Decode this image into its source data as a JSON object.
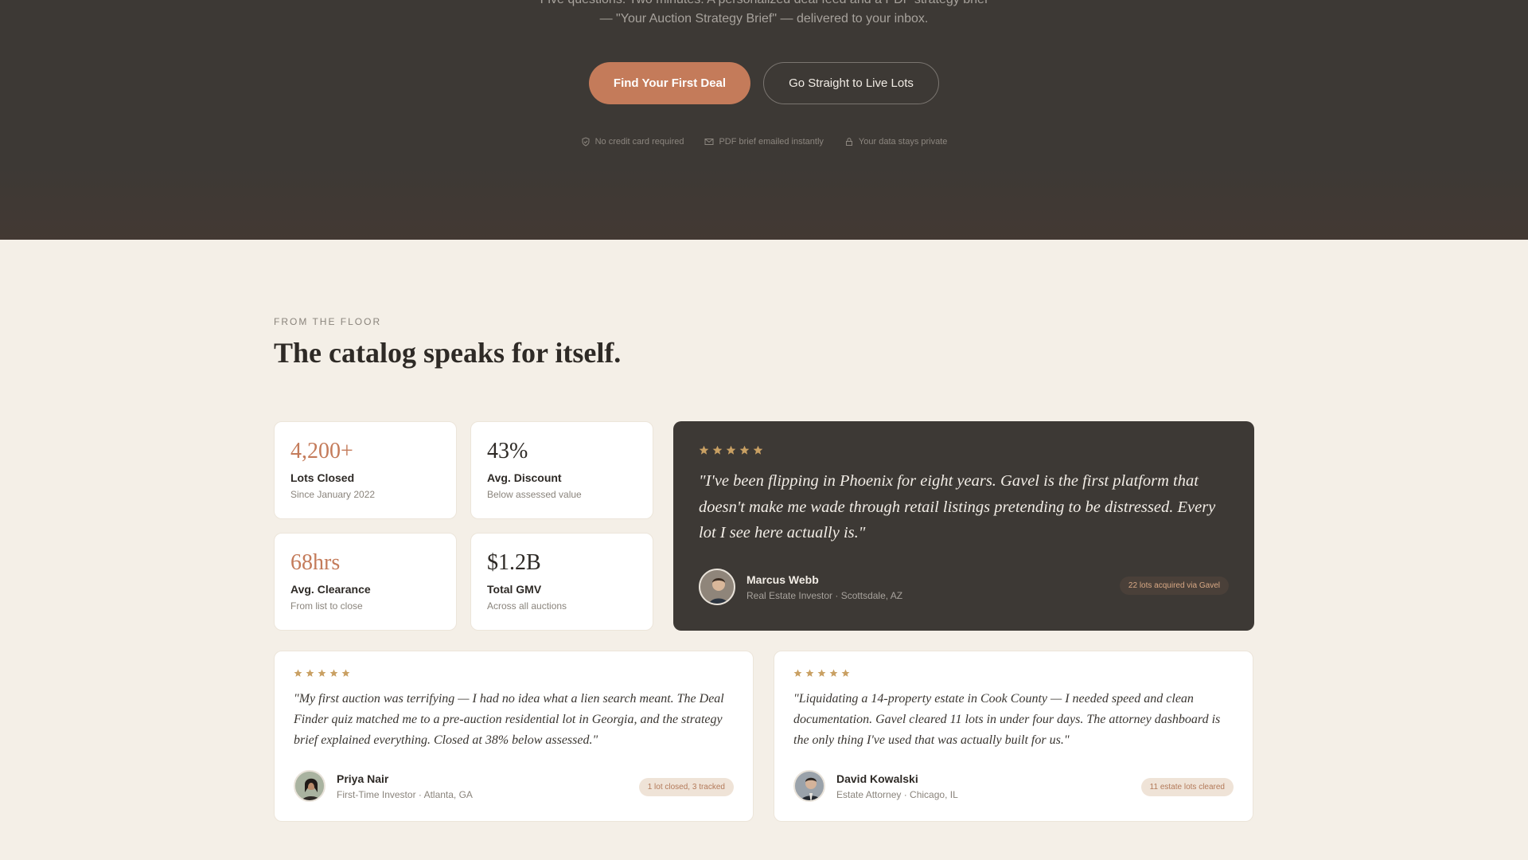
{
  "hero": {
    "subtitle_line1": "Five questions. Two minutes. A personalized deal feed and a PDF strategy brief",
    "subtitle_line2": "— \"Your Auction Strategy Brief\" — delivered to your inbox.",
    "primary_cta": "Find Your First Deal",
    "secondary_cta": "Go Straight to Live Lots",
    "trust": [
      {
        "icon": "shield-check-icon",
        "label": "No credit card required"
      },
      {
        "icon": "mail-icon",
        "label": "PDF brief emailed instantly"
      },
      {
        "icon": "lock-icon",
        "label": "Your data stays private"
      }
    ]
  },
  "section": {
    "eyebrow": "FROM THE FLOOR",
    "title": "The catalog speaks for itself."
  },
  "stats": [
    {
      "value": "4,200+",
      "label": "Lots Closed",
      "sub": "Since January 2022"
    },
    {
      "value": "43%",
      "label": "Avg. Discount",
      "sub": "Below assessed value"
    },
    {
      "value": "68hrs",
      "label": "Avg. Clearance",
      "sub": "From list to close"
    },
    {
      "value": "$1.2B",
      "label": "Total GMV",
      "sub": "Across all auctions"
    }
  ],
  "featured": {
    "rating": 5,
    "quote": "\"I've been flipping in Phoenix for eight years. Gavel is the first platform that doesn't make me wade through retail listings pretending to be distressed. Every lot I see here actually is.\"",
    "name": "Marcus Webb",
    "role": "Real Estate Investor · Scottsdale, AZ",
    "badge": "22 lots acquired via Gavel"
  },
  "testimonials": [
    {
      "rating": 5,
      "quote": "\"My first auction was terrifying — I had no idea what a lien search meant. The Deal Finder quiz matched me to a pre-auction residential lot in Georgia, and the strategy brief explained everything. Closed at 38% below assessed.\"",
      "name": "Priya Nair",
      "role": "First-Time Investor · Atlanta, GA",
      "badge": "1 lot closed, 3 tracked"
    },
    {
      "rating": 5,
      "quote": "\"Liquidating a 14-property estate in Cook County — I needed speed and clean documentation. Gavel cleared 11 lots in under four days. The attorney dashboard is the only thing I've used that was actually built for us.\"",
      "name": "David Kowalski",
      "role": "Estate Attorney · Chicago, IL",
      "badge": "11 estate lots cleared"
    }
  ],
  "colors": {
    "accent": "#c47b5a",
    "dark": "#3d3935",
    "star": "#c9a063",
    "background": "#f4efe7"
  }
}
